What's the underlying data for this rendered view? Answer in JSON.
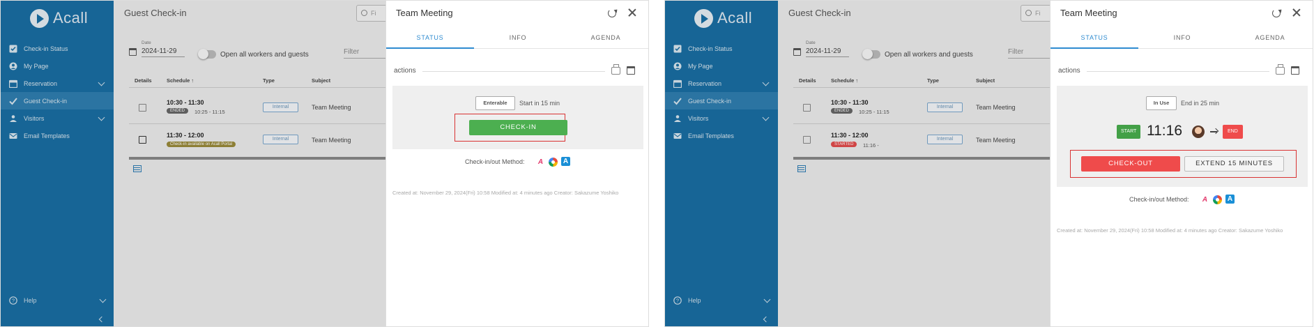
{
  "colors": {
    "sidebar": "#1a6ea3",
    "accent": "#2e8bd0",
    "checkin": "#4caf50",
    "danger": "#ef4b4b",
    "highlight_box": "#d93232"
  },
  "left": {
    "sidebar": {
      "logo_text": "Acall",
      "items": [
        {
          "label": "Check-in Status",
          "icon": "check-square-icon"
        },
        {
          "label": "My Page",
          "icon": "person-icon"
        },
        {
          "label": "Reservation",
          "icon": "calendar-icon"
        },
        {
          "label": "Guest Check-in",
          "icon": "checkmark-icon"
        },
        {
          "label": "Visitors",
          "icon": "people-icon"
        },
        {
          "label": "Email Templates",
          "icon": "mail-icon"
        }
      ],
      "help_label": "Help"
    },
    "main": {
      "title": "Guest Check-in",
      "find_placeholder": "Fi",
      "date_label": "Date",
      "date_value": "2024-11-29",
      "toggle_label": "Open all workers and guests",
      "filter_placeholder": "Filter",
      "headers": {
        "details": "Details",
        "schedule": "Schedule ↑",
        "type": "Type",
        "subject": "Subject"
      },
      "rows": [
        {
          "time": "10:30 - 11:30",
          "badge": "ENDED",
          "sub": "10:25 - 11:15",
          "type": "Internal",
          "subject": "Team Meeting"
        },
        {
          "time": "11:30 - 12:00",
          "badge": "Check-in available on Acall Portal",
          "sub": "",
          "type": "Internal",
          "subject": "Team Meeting"
        }
      ]
    },
    "modal": {
      "title": "Team Meeting",
      "tabs": [
        "STATUS",
        "INFO",
        "AGENDA"
      ],
      "actions_label": "actions",
      "status_chip": "Enterable",
      "status_text": "Start in 15 min",
      "checkin_label": "CHECK-IN",
      "method_label": "Check-in/out Method:",
      "footer": "Created at: November 29, 2024(Fri) 10:58 Modified at: 4 minutes ago Creator: Sakazume Yoshiko"
    }
  },
  "right": {
    "sidebar": {
      "logo_text": "Acall",
      "items": [
        {
          "label": "Check-in Status",
          "icon": "check-square-icon"
        },
        {
          "label": "My Page",
          "icon": "person-icon"
        },
        {
          "label": "Reservation",
          "icon": "calendar-icon"
        },
        {
          "label": "Guest Check-in",
          "icon": "checkmark-icon"
        },
        {
          "label": "Visitors",
          "icon": "people-icon"
        },
        {
          "label": "Email Templates",
          "icon": "mail-icon"
        }
      ],
      "help_label": "Help"
    },
    "main": {
      "title": "Guest Check-in",
      "find_placeholder": "Fi",
      "date_label": "Date",
      "date_value": "2024-11-29",
      "toggle_label": "Open all workers and guests",
      "filter_placeholder": "Filter",
      "headers": {
        "details": "Details",
        "schedule": "Schedule ↑",
        "type": "Type",
        "subject": "Subject"
      },
      "rows": [
        {
          "time": "10:30 - 11:30",
          "badge": "ENDED",
          "sub": "10:25 - 11:15",
          "type": "Internal",
          "subject": "Team Meeting"
        },
        {
          "time": "11:30 - 12:00",
          "badge": "STARTED",
          "sub": "11:16 -",
          "type": "Internal",
          "subject": "Team Meeting"
        }
      ]
    },
    "modal": {
      "title": "Team Meeting",
      "tabs": [
        "STATUS",
        "INFO",
        "AGENDA"
      ],
      "actions_label": "actions",
      "status_chip": "In Use",
      "status_text": "End in 25 min",
      "start_label": "START",
      "current_time": "11:16",
      "end_label": "END",
      "checkout_label": "CHECK-OUT",
      "extend_label": "EXTEND 15 MINUTES",
      "method_label": "Check-in/out Method:",
      "footer": "Created at: November 29, 2024(Fri) 10:58 Modified at: 4 minutes ago Creator: Sakazume Yoshiko"
    }
  }
}
